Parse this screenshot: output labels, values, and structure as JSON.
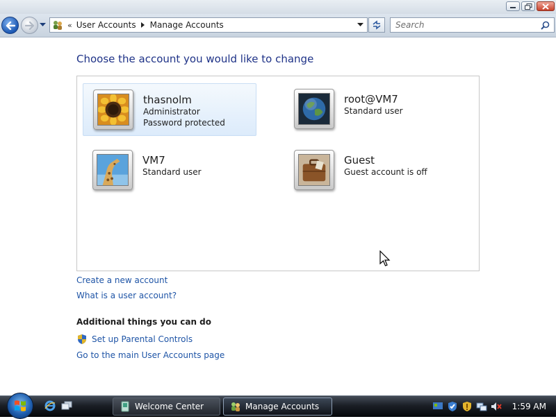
{
  "window": {
    "controls": {
      "minimize_icon": "minimize-icon",
      "maximize_icon": "restore-icon",
      "close_icon": "close-icon"
    }
  },
  "navbar": {
    "breadcrumb": [
      "User Accounts",
      "Manage Accounts"
    ],
    "overflow_chevrons": "«",
    "search_placeholder": "Search"
  },
  "main": {
    "heading": "Choose the account you would like to change",
    "accounts": [
      {
        "name": "thasnolm",
        "lines": [
          "Administrator",
          "Password protected"
        ],
        "avatar": "sunflower",
        "selected": true
      },
      {
        "name": "root@VM7",
        "lines": [
          "Standard user"
        ],
        "avatar": "globe",
        "selected": false
      },
      {
        "name": "VM7",
        "lines": [
          "Standard user"
        ],
        "avatar": "giraffe",
        "selected": false
      },
      {
        "name": "Guest",
        "lines": [
          "Guest account is off"
        ],
        "avatar": "briefcase",
        "selected": false
      }
    ],
    "links": {
      "create_account": "Create a new account",
      "what_is": "What is a user account?"
    },
    "additional": {
      "title": "Additional things you can do",
      "parental_controls": "Set up Parental Controls",
      "main_page": "Go to the main User Accounts page"
    }
  },
  "taskbar": {
    "tasks": [
      {
        "label": "Welcome Center",
        "icon": "welcome-center-icon",
        "active": false
      },
      {
        "label": "Manage Accounts",
        "icon": "user-accounts-icon",
        "active": true
      }
    ],
    "clock": "1:59 AM"
  },
  "colors": {
    "link": "#1e54a6",
    "heading": "#1e3287",
    "selection": "#dcebfb"
  }
}
